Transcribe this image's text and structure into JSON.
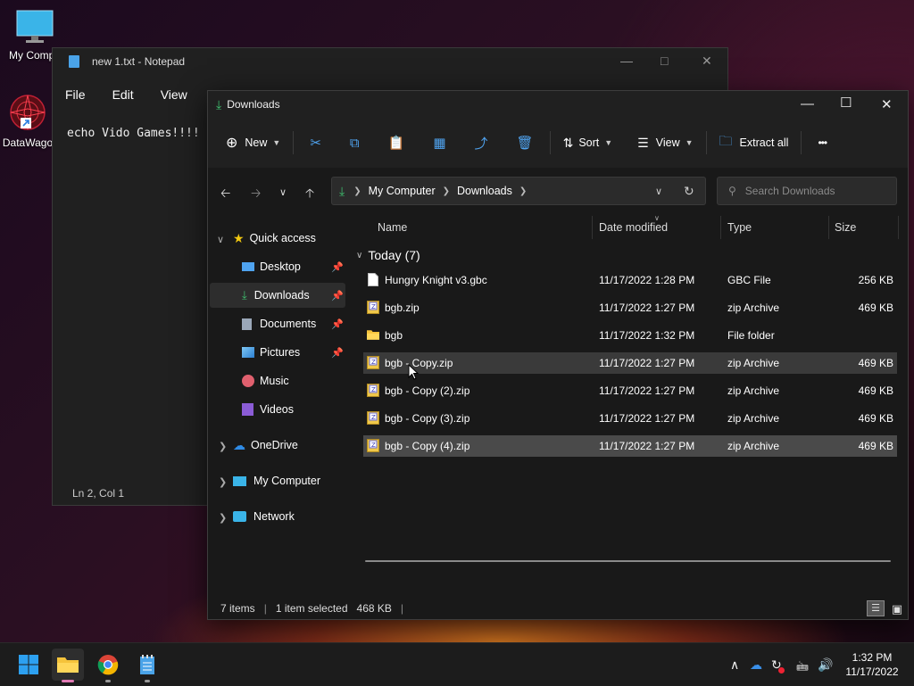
{
  "desktop": {
    "icons": [
      {
        "label": "My Compu"
      },
      {
        "label": "DataWago"
      }
    ]
  },
  "notepad": {
    "title": "new 1.txt - Notepad",
    "menu": [
      "File",
      "Edit",
      "View"
    ],
    "text": "echo Vido Games!!!!",
    "status": "Ln 2, Col 1"
  },
  "explorer": {
    "title": "Downloads",
    "toolbar": {
      "new": "New",
      "sort": "Sort",
      "view": "View",
      "extract_all": "Extract all",
      "more": "•••"
    },
    "address": {
      "root": "My Computer",
      "current": "Downloads"
    },
    "search_placeholder": "Search Downloads",
    "sidebar": {
      "quick_access": "Quick access",
      "items": [
        {
          "label": "Desktop"
        },
        {
          "label": "Downloads"
        },
        {
          "label": "Documents"
        },
        {
          "label": "Pictures"
        },
        {
          "label": "Music"
        },
        {
          "label": "Videos"
        }
      ],
      "onedrive": "OneDrive",
      "my_computer": "My Computer",
      "network": "Network"
    },
    "columns": {
      "name": "Name",
      "date": "Date modified",
      "type": "Type",
      "size": "Size"
    },
    "group_label": "Today (7)",
    "files": [
      {
        "name": "Hungry Knight v3.gbc",
        "date": "11/17/2022 1:28 PM",
        "type": "GBC File",
        "size": "256 KB",
        "kind": "file"
      },
      {
        "name": "bgb.zip",
        "date": "11/17/2022 1:27 PM",
        "type": "zip Archive",
        "size": "469 KB",
        "kind": "zip"
      },
      {
        "name": "bgb",
        "date": "11/17/2022 1:32 PM",
        "type": "File folder",
        "size": "",
        "kind": "folder"
      },
      {
        "name": "bgb - Copy.zip",
        "date": "11/17/2022 1:27 PM",
        "type": "zip Archive",
        "size": "469 KB",
        "kind": "zip"
      },
      {
        "name": "bgb - Copy (2).zip",
        "date": "11/17/2022 1:27 PM",
        "type": "zip Archive",
        "size": "469 KB",
        "kind": "zip"
      },
      {
        "name": "bgb - Copy (3).zip",
        "date": "11/17/2022 1:27 PM",
        "type": "zip Archive",
        "size": "469 KB",
        "kind": "zip"
      },
      {
        "name": "bgb - Copy (4).zip",
        "date": "11/17/2022 1:27 PM",
        "type": "zip Archive",
        "size": "469 KB",
        "kind": "zip"
      }
    ],
    "status": {
      "items": "7 items",
      "selected": "1 item selected",
      "selected_size": "468 KB"
    }
  },
  "taskbar": {
    "time": "1:32 PM",
    "date": "11/17/2022"
  }
}
